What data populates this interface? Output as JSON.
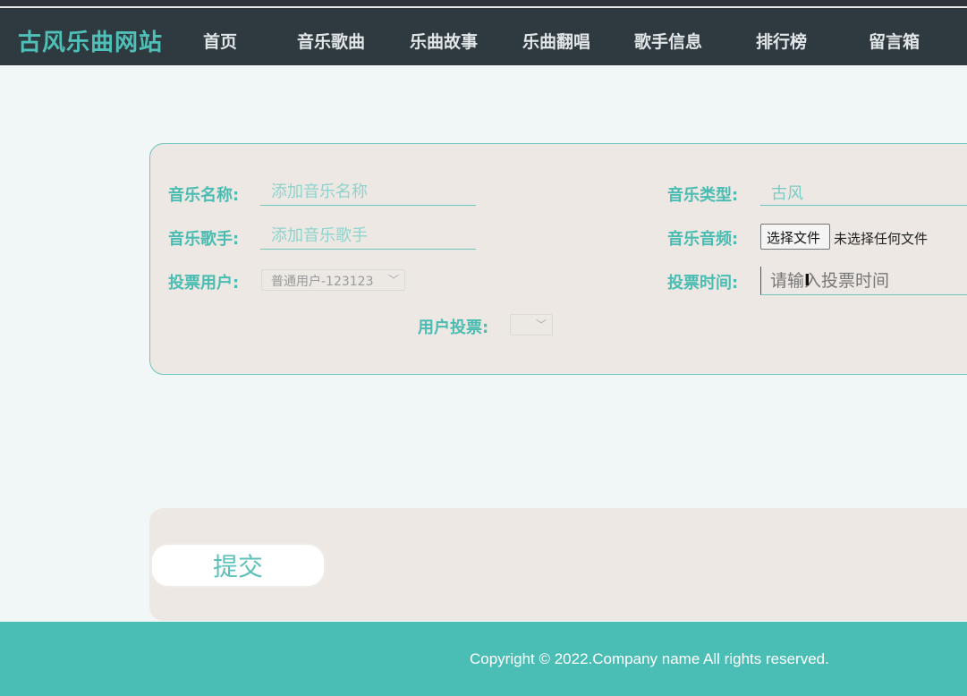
{
  "nav": {
    "brand": "古风乐曲网站",
    "items": [
      "首页",
      "音乐歌曲",
      "乐曲故事",
      "乐曲翻唱",
      "歌手信息",
      "排行榜",
      "留言箱"
    ]
  },
  "form": {
    "music_name_label": "音乐名称:",
    "music_name_placeholder": "添加音乐名称",
    "music_type_label": "音乐类型:",
    "music_type_value": "古风",
    "singer_label": "音乐歌手:",
    "singer_placeholder": "添加音乐歌手",
    "audio_label": "音乐音频:",
    "file_button": "选择文件",
    "file_status": "未选择任何文件",
    "vote_user_label": "投票用户:",
    "vote_user_value": "普通用户-123123",
    "vote_time_label": "投票时间:",
    "vote_time_placeholder": "请输入投票时间",
    "user_vote_label": "用户投票:",
    "user_vote_value": ""
  },
  "submit_label": "提交",
  "footer": {
    "copyright": "Copyright © 2022.Company name All rights reserved."
  },
  "colors": {
    "accent": "#4bbcb2",
    "nav_bg": "#2f3a40",
    "card_bg": "#ede8e3",
    "footer_bg": "#4abdb5"
  }
}
